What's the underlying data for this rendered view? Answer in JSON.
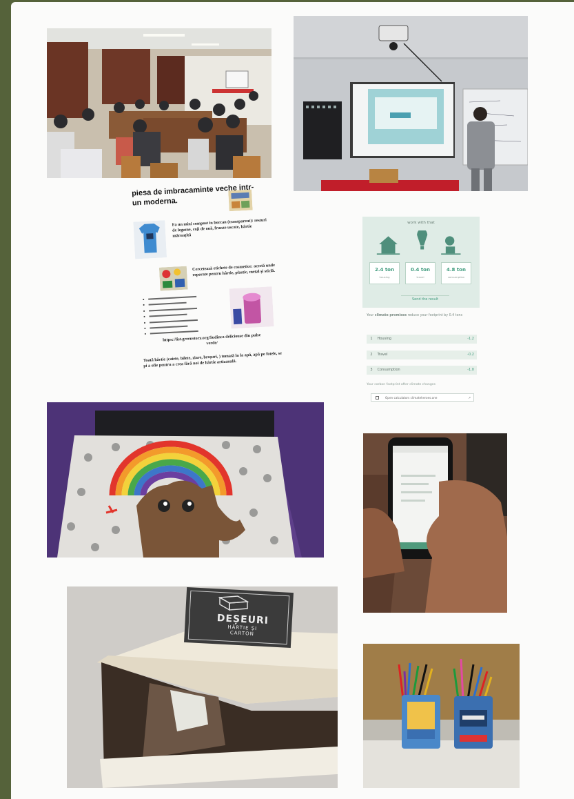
{
  "document": {
    "title": "piesa de imbracaminte veche intr-un moderna.",
    "para1": "Fa un mini compost in borcan (transparent): resturi de legume, coji de ouă, frunze uscate, hârtie mărunțită",
    "para2": "Cercetează etichete de cosmetice: acestă unde reperate pentru hârtie, plastic, metal și sticlă.",
    "url": "https://list.greenstory.org/Sudinca deliciouse din pulse verde/",
    "footer": "Toată hârtie (caiete, bilete, ziare, broșuri, ) tomată în la apă, apă pe fotele, se pi a ofie pentru a crea fără noi de hârtie artizanală.",
    "list_item_count": 7
  },
  "calculator": {
    "header": "work with that",
    "cards": [
      {
        "value": "2.4 ton",
        "label": "housing"
      },
      {
        "value": "0.4 ton",
        "label": "travel"
      },
      {
        "value": "4.8 ton",
        "label": "consumption"
      }
    ],
    "button": "Send the result",
    "note_prefix": "Your",
    "note_bold": "climate promises",
    "note_suffix": "reduce your footprint by 0.4 tons",
    "rows": [
      {
        "n": "1",
        "label": "Housing",
        "value": "-1.2"
      },
      {
        "n": "2",
        "label": "Travel",
        "value": "-0.2"
      },
      {
        "n": "3",
        "label": "Consumption",
        "value": "-1.0"
      }
    ],
    "footer": "Your carbon footprint after climate changes",
    "link": "Open calculators climateheroes.one",
    "link_arrow": "↗"
  },
  "box_label": {
    "line1": "DEȘEURI",
    "line2": "HÂRTIE ȘI",
    "line3": "CARTON"
  },
  "colors": {
    "frame": "#55623a",
    "paper": "#fbfbfa",
    "calc_accent": "#3d9a7c",
    "calc_panel": "#dfece6"
  }
}
